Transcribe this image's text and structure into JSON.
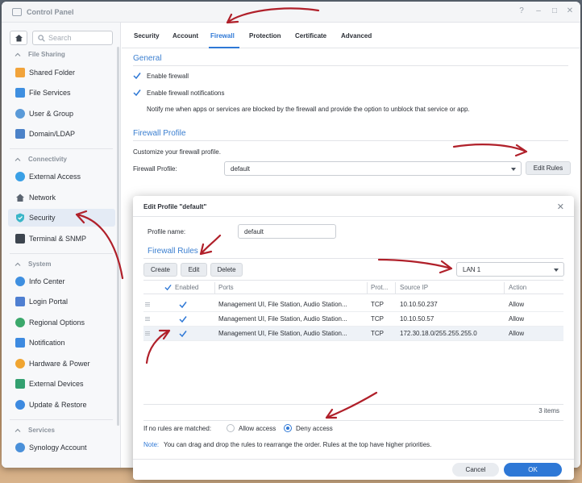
{
  "window": {
    "title": "Control Panel",
    "help": "?",
    "minimize": "–",
    "maximize": "□",
    "close": "✕"
  },
  "sidebar": {
    "search_placeholder": "Search",
    "sections": [
      {
        "title": "File Sharing",
        "items": [
          "Shared Folder",
          "File Services",
          "User & Group",
          "Domain/LDAP"
        ]
      },
      {
        "title": "Connectivity",
        "items": [
          "External Access",
          "Network",
          "Security",
          "Terminal & SNMP"
        ]
      },
      {
        "title": "System",
        "items": [
          "Info Center",
          "Login Portal",
          "Regional Options",
          "Notification",
          "Hardware & Power",
          "External Devices",
          "Update & Restore"
        ]
      },
      {
        "title": "Services",
        "items": [
          "Synology Account"
        ]
      }
    ],
    "active_item": "Security"
  },
  "tabs": [
    "Security",
    "Account",
    "Firewall",
    "Protection",
    "Certificate",
    "Advanced"
  ],
  "active_tab": "Firewall",
  "general": {
    "title": "General",
    "enable_firewall": "Enable firewall",
    "enable_notifications": "Enable firewall notifications",
    "notify_text": "Notify me when apps or services are blocked by the firewall and provide the option to unblock that service or app."
  },
  "profile": {
    "title": "Firewall Profile",
    "description": "Customize your firewall profile.",
    "label": "Firewall Profile:",
    "value": "default",
    "edit_rules": "Edit Rules"
  },
  "dialog": {
    "title": "Edit Profile \"default\"",
    "close": "✕",
    "profile_name_label": "Profile name:",
    "profile_name_value": "default",
    "rules_title": "Firewall Rules",
    "buttons": {
      "create": "Create",
      "edit": "Edit",
      "delete": "Delete"
    },
    "interface": "LAN 1",
    "columns": {
      "enabled": "Enabled",
      "ports": "Ports",
      "protocol": "Prot...",
      "source": "Source IP",
      "action": "Action"
    },
    "rows": [
      {
        "ports": "Management UI, File Station, Audio Station...",
        "protocol": "TCP",
        "source": "10.10.50.237",
        "action": "Allow"
      },
      {
        "ports": "Management UI, File Station, Audio Station...",
        "protocol": "TCP",
        "source": "10.10.50.57",
        "action": "Allow"
      },
      {
        "ports": "Management UI, File Station, Audio Station...",
        "protocol": "TCP",
        "source": "172.30.18.0/255.255.255.0",
        "action": "Allow"
      }
    ],
    "items_count": "3 items",
    "no_match_label": "If no rules are matched:",
    "allow_access": "Allow access",
    "deny_access": "Deny access",
    "note_label": "Note:",
    "note_text": "You can drag and drop the rules to rearrange the order. Rules at the top have higher priorities.",
    "cancel": "Cancel",
    "ok": "OK"
  },
  "colors": {
    "accent": "#2e78d6",
    "annotation": "#b0202a"
  }
}
